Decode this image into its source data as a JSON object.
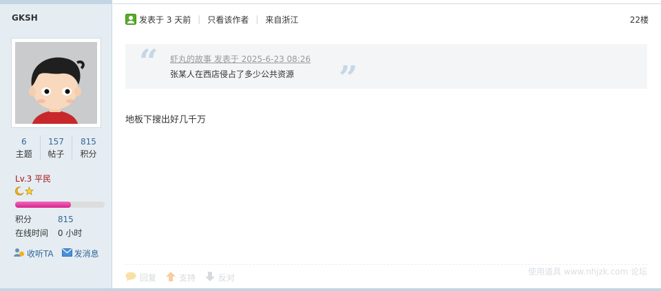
{
  "profile": {
    "username": "GKSH",
    "stats": [
      {
        "value": "6",
        "label": "主题"
      },
      {
        "value": "157",
        "label": "帖子"
      },
      {
        "value": "815",
        "label": "积分"
      }
    ],
    "level": "Lv.3 平民",
    "level_progress": 0.62,
    "points_label": "积分",
    "points_value": "815",
    "online_label": "在线时间",
    "online_value": "0 小时",
    "follow_label": "收听TA",
    "message_label": "发消息"
  },
  "post": {
    "posted_label": "发表于 3 天前",
    "author_only_label": "只看该作者",
    "from_label": "来自浙江",
    "floor": "22楼",
    "quote": {
      "meta": "虾丸的故事 发表于 2025-6-23 08:26",
      "text": "张某人在西店侵占了多少公共资源"
    },
    "body": "地板下搜出好几千万",
    "footer": {
      "reply": "回复",
      "support": "支持",
      "oppose": "反对"
    },
    "watermark": "使用道具  www.nhjzk.com 论坛"
  },
  "colors": {
    "sidebar_bg": "#e5edf2",
    "link": "#336699",
    "level": "#a3151a"
  }
}
